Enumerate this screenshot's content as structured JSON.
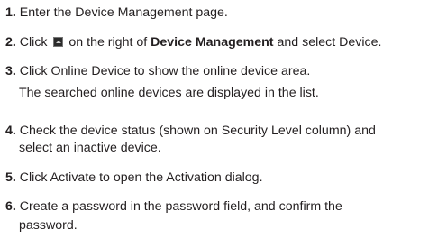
{
  "steps": [
    {
      "num": "1.",
      "text": " Enter the Device Management page."
    },
    {
      "num": "2.",
      "pre": " Click ",
      "icon": "dropdown-button-icon",
      "mid": " on the right of ",
      "bold": "Device Management",
      "post": " and select Device."
    },
    {
      "num": "3.",
      "text": " Click Online Device to show the online device area.",
      "note": "The searched online devices are displayed in the list."
    },
    {
      "num": "4.",
      "text": " Check the device status (shown on Security Level column) and",
      "cont": "select an inactive device."
    },
    {
      "num": "5.",
      "text": " Click Activate to open the Activation dialog."
    },
    {
      "num": "6.",
      "text": " Create a password in the password field, and confirm the",
      "cont": "password."
    }
  ]
}
